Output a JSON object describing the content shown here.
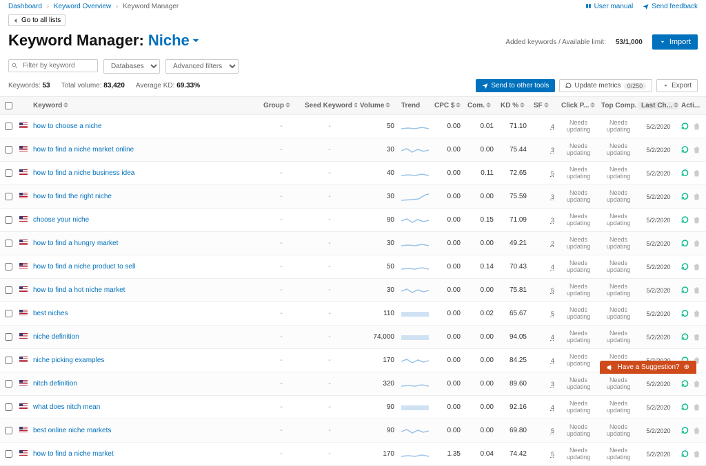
{
  "breadcrumb": [
    "Dashboard",
    "Keyword Overview",
    "Keyword Manager"
  ],
  "toplinks": {
    "manual": "User manual",
    "feedback": "Send feedback"
  },
  "goback": "Go to all lists",
  "title": {
    "prefix": "Keyword Manager:",
    "niche": "Niche"
  },
  "limit": {
    "label": "Added keywords / Available limit:",
    "value": "53/1,000"
  },
  "import_btn": "Import",
  "filters": {
    "placeholder": "Filter by keyword",
    "db": "Databases",
    "adv": "Advanced filters"
  },
  "stats": {
    "kw_label": "Keywords:",
    "kw_val": "53",
    "vol_label": "Total volume:",
    "vol_val": "83,420",
    "kd_label": "Average KD:",
    "kd_val": "69.33%"
  },
  "buttons": {
    "send": "Send to other tools",
    "update": "Update metrics",
    "update_badge": "0/250",
    "export": "Export"
  },
  "columns": {
    "keyword": "Keyword",
    "group": "Group",
    "seed": "Seed Keyword",
    "volume": "Volume",
    "trend": "Trend",
    "cpc": "CPC $",
    "com": "Com.",
    "kd": "KD %",
    "sf": "SF",
    "click": "Click P...",
    "topcomp": "Top Comp.",
    "lastch": "Last Ch...",
    "acti": "Acti..."
  },
  "needs_text": "Needs updating",
  "chart_data": {
    "type": "table",
    "title": "Keyword Manager — Niche list",
    "columns": [
      "Keyword",
      "Group",
      "Seed Keyword",
      "Volume",
      "CPC $",
      "Com.",
      "KD %",
      "SF",
      "Click Potential",
      "Top Comp.",
      "Last Checked"
    ],
    "rows": [
      [
        "how to choose a niche",
        "-",
        "-",
        50,
        0.0,
        0.01,
        71.1,
        4,
        "Needs updating",
        "Needs updating",
        "5/2/2020"
      ],
      [
        "how to find a niche market online",
        "-",
        "-",
        30,
        0.0,
        0.0,
        75.44,
        3,
        "Needs updating",
        "Needs updating",
        "5/2/2020"
      ],
      [
        "how to find a niche business idea",
        "-",
        "-",
        40,
        0.0,
        0.11,
        72.65,
        5,
        "Needs updating",
        "Needs updating",
        "5/2/2020"
      ],
      [
        "how to find the right niche",
        "-",
        "-",
        30,
        0.0,
        0.0,
        75.59,
        3,
        "Needs updating",
        "Needs updating",
        "5/2/2020"
      ],
      [
        "choose your niche",
        "-",
        "-",
        90,
        0.0,
        0.15,
        71.09,
        3,
        "Needs updating",
        "Needs updating",
        "5/2/2020"
      ],
      [
        "how to find a hungry market",
        "-",
        "-",
        30,
        0.0,
        0.0,
        49.21,
        2,
        "Needs updating",
        "Needs updating",
        "5/2/2020"
      ],
      [
        "how to find a niche product to sell",
        "-",
        "-",
        50,
        0.0,
        0.14,
        70.43,
        4,
        "Needs updating",
        "Needs updating",
        "5/2/2020"
      ],
      [
        "how to find a hot niche market",
        "-",
        "-",
        30,
        0.0,
        0.0,
        75.81,
        5,
        "Needs updating",
        "Needs updating",
        "5/2/2020"
      ],
      [
        "best niches",
        "-",
        "-",
        110,
        0.0,
        0.02,
        65.67,
        5,
        "Needs updating",
        "Needs updating",
        "5/2/2020"
      ],
      [
        "niche definition",
        "-",
        "-",
        74000,
        0.0,
        0.0,
        94.05,
        4,
        "Needs updating",
        "Needs updating",
        "5/2/2020"
      ],
      [
        "niche picking examples",
        "-",
        "-",
        170,
        0.0,
        0.0,
        84.25,
        4,
        "Needs updating",
        "Needs updating",
        "5/2/2020"
      ],
      [
        "nitch definition",
        "-",
        "-",
        320,
        0.0,
        0.0,
        89.6,
        3,
        "Needs updating",
        "Needs updating",
        "5/2/2020"
      ],
      [
        "what does nitch mean",
        "-",
        "-",
        90,
        0.0,
        0.0,
        92.16,
        4,
        "Needs updating",
        "Needs updating",
        "5/2/2020"
      ],
      [
        "best online niche markets",
        "-",
        "-",
        90,
        0.0,
        0.0,
        69.8,
        5,
        "Needs updating",
        "Needs updating",
        "5/2/2020"
      ],
      [
        "how to find a niche market",
        "-",
        "-",
        170,
        1.35,
        0.04,
        74.42,
        5,
        "Needs updating",
        "Needs updating",
        "5/2/2020"
      ]
    ]
  },
  "rows": [
    {
      "kw": "how to choose a niche",
      "vol": "50",
      "cpc": "0.00",
      "com": "0.01",
      "kd": "71.10",
      "sf": "4",
      "date": "5/2/2020",
      "trend": "flat"
    },
    {
      "kw": "how to find a niche market online",
      "vol": "30",
      "cpc": "0.00",
      "com": "0.00",
      "kd": "75.44",
      "sf": "3",
      "date": "5/2/2020",
      "trend": "wavy"
    },
    {
      "kw": "how to find a niche business idea",
      "vol": "40",
      "cpc": "0.00",
      "com": "0.11",
      "kd": "72.65",
      "sf": "5",
      "date": "5/2/2020",
      "trend": "flat"
    },
    {
      "kw": "how to find the right niche",
      "vol": "30",
      "cpc": "0.00",
      "com": "0.00",
      "kd": "75.59",
      "sf": "3",
      "date": "5/2/2020",
      "trend": "rise"
    },
    {
      "kw": "choose your niche",
      "vol": "90",
      "cpc": "0.00",
      "com": "0.15",
      "kd": "71.09",
      "sf": "3",
      "date": "5/2/2020",
      "trend": "wavy"
    },
    {
      "kw": "how to find a hungry market",
      "vol": "30",
      "cpc": "0.00",
      "com": "0.00",
      "kd": "49.21",
      "sf": "2",
      "date": "5/2/2020",
      "trend": "flat"
    },
    {
      "kw": "how to find a niche product to sell",
      "vol": "50",
      "cpc": "0.00",
      "com": "0.14",
      "kd": "70.43",
      "sf": "4",
      "date": "5/2/2020",
      "trend": "flat"
    },
    {
      "kw": "how to find a hot niche market",
      "vol": "30",
      "cpc": "0.00",
      "com": "0.00",
      "kd": "75.81",
      "sf": "5",
      "date": "5/2/2020",
      "trend": "wavy"
    },
    {
      "kw": "best niches",
      "vol": "110",
      "cpc": "0.00",
      "com": "0.02",
      "kd": "65.67",
      "sf": "5",
      "date": "5/2/2020",
      "trend": "block"
    },
    {
      "kw": "niche definition",
      "vol": "74,000",
      "cpc": "0.00",
      "com": "0.00",
      "kd": "94.05",
      "sf": "4",
      "date": "5/2/2020",
      "trend": "block"
    },
    {
      "kw": "niche picking examples",
      "vol": "170",
      "cpc": "0.00",
      "com": "0.00",
      "kd": "84.25",
      "sf": "4",
      "date": "5/2/2020",
      "trend": "wavy"
    },
    {
      "kw": "nitch definition",
      "vol": "320",
      "cpc": "0.00",
      "com": "0.00",
      "kd": "89.60",
      "sf": "3",
      "date": "5/2/2020",
      "trend": "flat"
    },
    {
      "kw": "what does nitch mean",
      "vol": "90",
      "cpc": "0.00",
      "com": "0.00",
      "kd": "92.16",
      "sf": "4",
      "date": "5/2/2020",
      "trend": "block"
    },
    {
      "kw": "best online niche markets",
      "vol": "90",
      "cpc": "0.00",
      "com": "0.00",
      "kd": "69.80",
      "sf": "5",
      "date": "5/2/2020",
      "trend": "wavy"
    },
    {
      "kw": "how to find a niche market",
      "vol": "170",
      "cpc": "1.35",
      "com": "0.04",
      "kd": "74.42",
      "sf": "5",
      "date": "5/2/2020",
      "trend": "flat"
    }
  ],
  "suggest": "Have a Suggestion?"
}
